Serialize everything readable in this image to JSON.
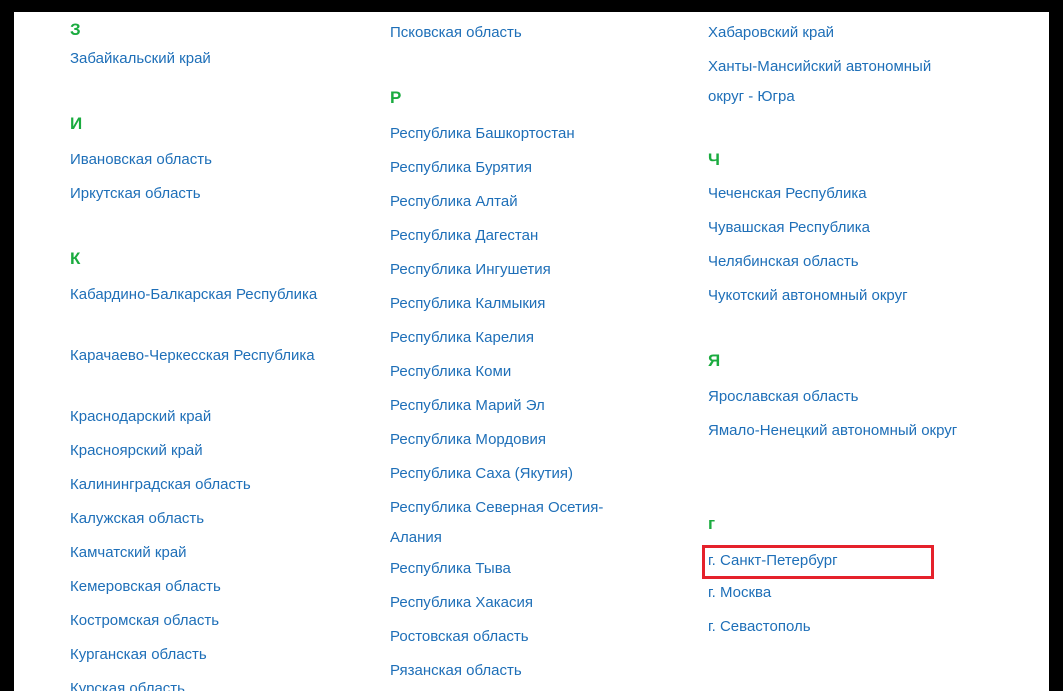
{
  "regions": {
    "col1": {
      "z_letter": "З",
      "zab": "Забайкальский край",
      "i_letter": "И",
      "ivan": "Ивановская область",
      "irk": "Иркутская область",
      "k_letter": "К",
      "kab": "Кабардино-Балкарская Республика",
      "kch": "Карачаево-Черкесская Республика",
      "krasnodar": "Краснодарский край",
      "krasnoyarsk": "Красноярский край",
      "kaliningrad": "Калининградская область",
      "kaluga": "Калужская область",
      "kamchatka": "Камчатский край",
      "kemerovo": "Кемеровская область",
      "kostroma": "Костромская область",
      "kurgan": "Курганская область",
      "kursk": "Курская область"
    },
    "col2": {
      "pskov": "Псковская область",
      "r_letter": "Р",
      "bash": "Республика Башкортостан",
      "bur": "Республика Бурятия",
      "altai": "Республика Алтай",
      "dag": "Республика Дагестан",
      "ing": "Республика Ингушетия",
      "kalm": "Республика Калмыкия",
      "kar": "Республика Карелия",
      "komi": "Республика Коми",
      "mari": "Республика Марий Эл",
      "mord": "Республика Мордовия",
      "saha": "Республика Саха (Якутия)",
      "oset": "Республика Северная Осетия-Алания",
      "tyva": "Республика Тыва",
      "khak": "Республика Хакасия",
      "rostov": "Ростовская область",
      "ryazan": "Рязанская область"
    },
    "col3": {
      "khab": "Хабаровский край",
      "khmao": "Ханты-Мансийский автономный округ - Югра",
      "ch_letter": "Ч",
      "chech": "Чеченская Республика",
      "chuv": "Чувашская Республика",
      "chel": "Челябинская область",
      "chuk": "Чукотский автономный округ",
      "ya_letter": "Я",
      "yar": "Ярославская область",
      "yamal": "Ямало-Ненецкий автономный округ",
      "g_letter": "г",
      "spb": "г. Санкт-Петербург",
      "msk": "г. Москва",
      "sev": "г. Севастополь"
    }
  },
  "colors": {
    "letter": "#1aab3f",
    "link": "#1e6fb8",
    "highlight": "#e5212b"
  }
}
